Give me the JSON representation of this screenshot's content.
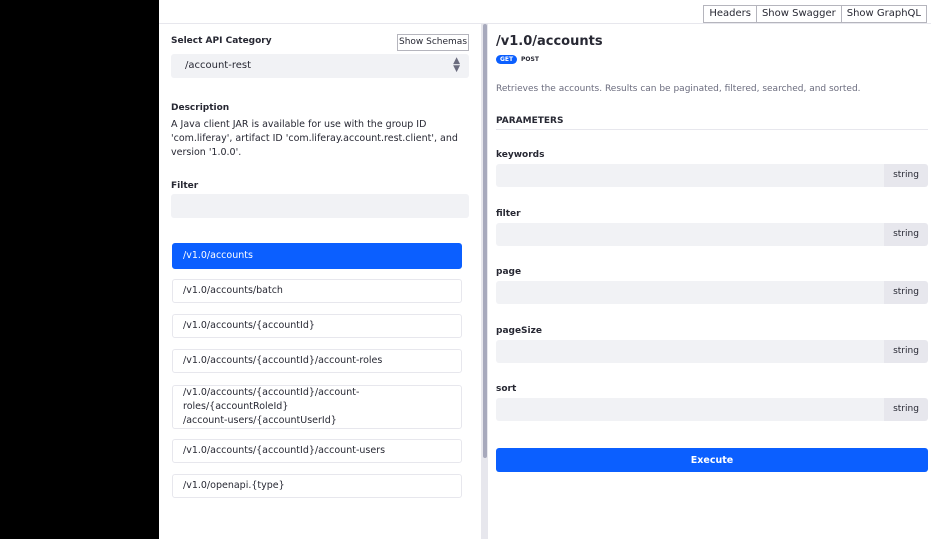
{
  "colors": {
    "accent": "#0b5fff",
    "input_bg": "#f1f2f5",
    "border": "#e7e7ed",
    "text": "#272833",
    "muted": "#6b6c7e",
    "outer_bg": "#000000"
  },
  "topbar": {
    "headers_label": "Headers",
    "swagger_label": "Show Swagger",
    "graphql_label": "Show GraphQL"
  },
  "sidebar": {
    "category_label": "Select API Category",
    "show_schemas_label": "Show Schemas",
    "category_value": "/account-rest",
    "select_icon": "select-arrows-icon",
    "description_label": "Description",
    "description_text": "A Java client JAR is available for use with the group ID 'com.liferay', artifact ID 'com.liferay.account.rest.client', and version '1.0.0'.",
    "filter_label": "Filter",
    "filter_value": "",
    "endpoints": [
      {
        "path": "/v1.0/accounts",
        "active": true
      },
      {
        "path": "/v1.0/accounts/batch",
        "active": false
      },
      {
        "path": "/v1.0/accounts/{accountId}",
        "active": false
      },
      {
        "path": "/v1.0/accounts/{accountId}/account-roles",
        "active": false
      },
      {
        "path": "/v1.0/accounts/{accountId}/account-roles/{accountRoleId}\n/account-users/{accountUserId}",
        "active": false
      },
      {
        "path": "/v1.0/accounts/{accountId}/account-users",
        "active": false
      },
      {
        "path": "/v1.0/openapi.{type}",
        "active": false
      }
    ]
  },
  "endpoint": {
    "title": "/v1.0/accounts",
    "methods": [
      "GET",
      "POST"
    ],
    "description": "Retrieves the accounts. Results can be paginated, filtered, searched, and sorted.",
    "parameters_heading": "PARAMETERS",
    "parameters": [
      {
        "name": "keywords",
        "type": "string",
        "value": ""
      },
      {
        "name": "filter",
        "type": "string",
        "value": ""
      },
      {
        "name": "page",
        "type": "string",
        "value": ""
      },
      {
        "name": "pageSize",
        "type": "string",
        "value": ""
      },
      {
        "name": "sort",
        "type": "string",
        "value": ""
      }
    ],
    "execute_label": "Execute"
  }
}
